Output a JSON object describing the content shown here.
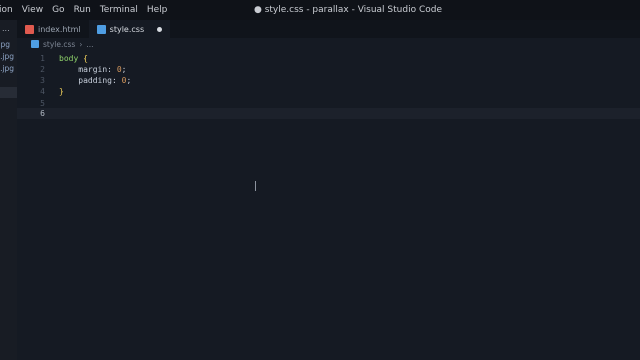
{
  "menu": [
    "ion",
    "View",
    "Go",
    "Run",
    "Terminal",
    "Help"
  ],
  "window_title": "● style.css - parallax - Visual Studio Code",
  "sidebar": {
    "header": "...",
    "files": [
      ".jpg",
      "l.jpg",
      "l.jpg"
    ]
  },
  "tabs": [
    {
      "label": "index.html",
      "icon": "html-file-icon",
      "color": "#e05a4f",
      "active": false
    },
    {
      "label": "style.css",
      "icon": "css-file-icon",
      "color": "#4f9ee3",
      "active": true,
      "modified": true
    }
  ],
  "breadcrumb": {
    "file": "style.css",
    "more": "..."
  },
  "editor": {
    "lines": [
      {
        "num": "1",
        "tokens": [
          [
            "sel",
            "body"
          ],
          [
            "punct",
            " "
          ],
          [
            "brace",
            "{"
          ]
        ]
      },
      {
        "num": "2",
        "tokens": [
          [
            "punct",
            "    "
          ],
          [
            "prop",
            "margin"
          ],
          [
            "punct",
            ": "
          ],
          [
            "num",
            "0"
          ],
          [
            "punct",
            ";"
          ]
        ]
      },
      {
        "num": "3",
        "tokens": [
          [
            "punct",
            "    "
          ],
          [
            "prop",
            "padding"
          ],
          [
            "punct",
            ": "
          ],
          [
            "num",
            "0"
          ],
          [
            "punct",
            ";"
          ]
        ]
      },
      {
        "num": "4",
        "tokens": [
          [
            "brace",
            "}"
          ]
        ]
      },
      {
        "num": "5",
        "tokens": []
      },
      {
        "num": "6",
        "tokens": [],
        "current": true
      }
    ]
  },
  "colors": {
    "background": "#151a23",
    "titlebar": "#0f1218",
    "accent": "#4f9ee3"
  }
}
